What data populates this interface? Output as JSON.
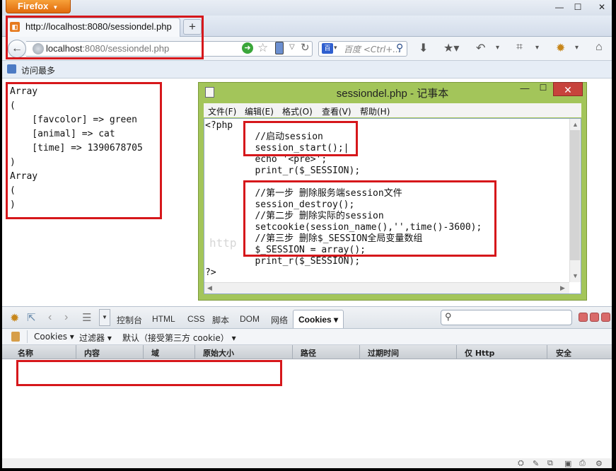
{
  "browser": {
    "app_button_label": "Firefox",
    "window_buttons": [
      "—",
      "☐",
      "✕"
    ],
    "tab": {
      "title": "http://localhost:8080/sessiondel.php"
    },
    "new_tab_label": "+",
    "url": {
      "host": "localhost",
      "rest": ":8080/sessiondel.php"
    },
    "search_placeholder": "百度 <Ctrl+...",
    "bookmark_label": "访问最多"
  },
  "page": {
    "output": "Array\n(\n    [favcolor] => green\n    [animal] => cat\n    [time] => 1390678705\n)\nArray\n(\n)"
  },
  "notepad": {
    "title": "sessiondel.php - 记事本",
    "menu": [
      "文件(F)",
      "编辑(E)",
      "格式(O)",
      "查看(V)",
      "帮助(H)"
    ],
    "code": "<?php\n         //启动session\n         session_start();|\n         echo '<pre>';\n         print_r($_SESSION);\n\n         //第一步 删除服务端session文件\n         session_destroy();\n         //第二步 删除实际的session\n         setcookie(session_name(),'',time()-3600);\n         //第三步 删除$_SESSION全局变量数组\n         $_SESSION = array();\n         print_r($_SESSION);\n?>"
  },
  "watermark": "http",
  "firebug": {
    "tabs": [
      "控制台",
      "HTML",
      "CSS",
      "脚本",
      "DOM",
      "网络"
    ],
    "active_tab": "Cookies ▾",
    "cookie_toolbar": [
      "Cookies ▾",
      "过滤器 ▾",
      "默认（接受第三方 cookie） ▾"
    ],
    "columns": [
      "名称",
      "内容",
      "域",
      "原始大小",
      "路径",
      "过期时间",
      "仅 Http",
      "安全"
    ]
  },
  "colors": {
    "annotation_red": "#d6171b",
    "notepad_frame": "#a3c55a",
    "firefox_orange": "#e06a0b"
  }
}
